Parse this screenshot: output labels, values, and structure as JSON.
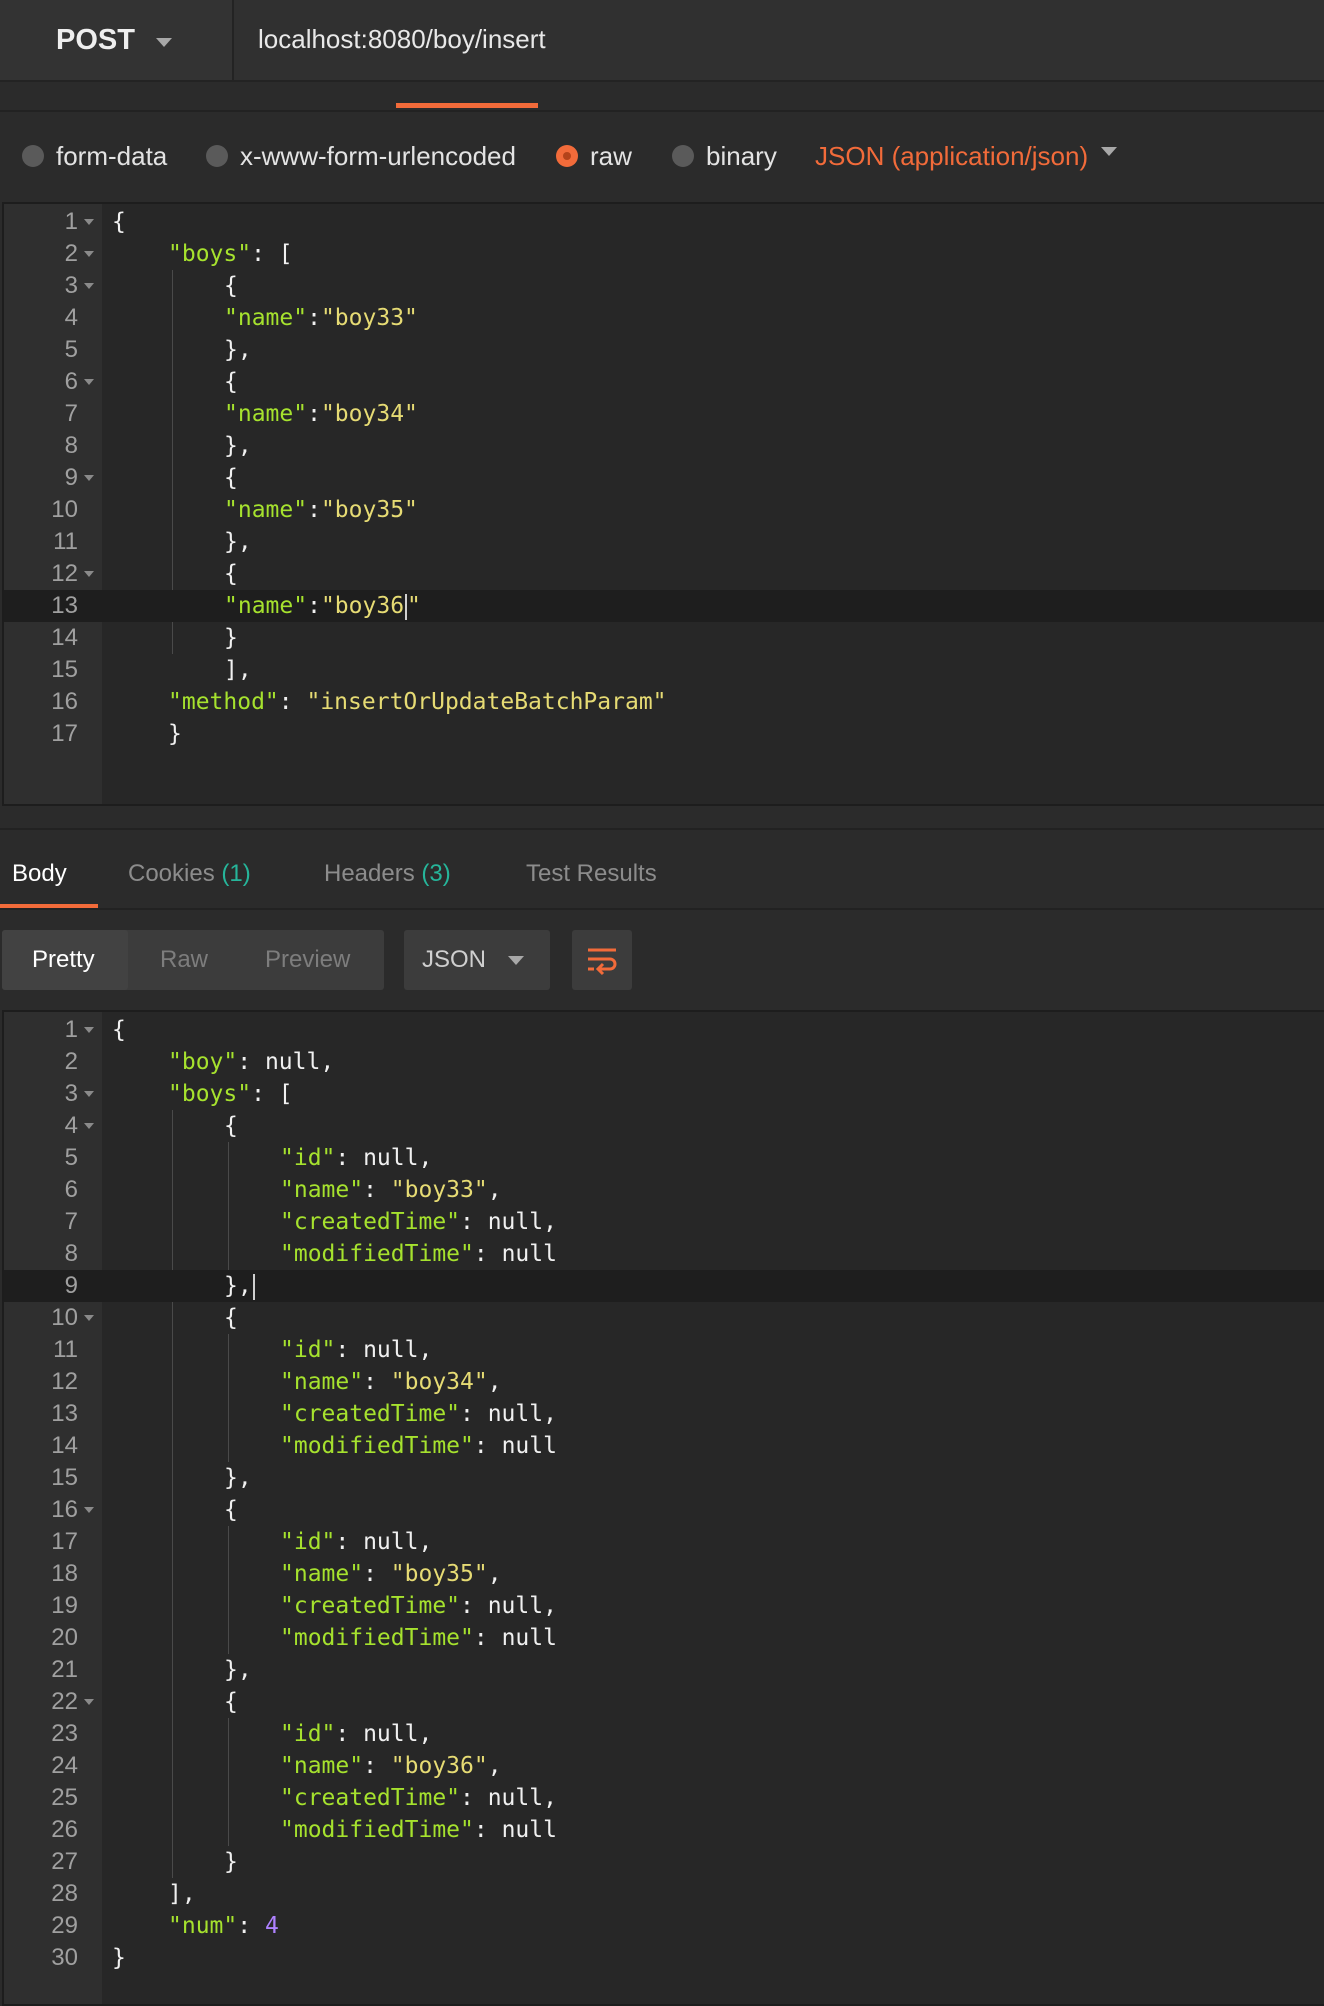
{
  "request": {
    "method": "POST",
    "url": "localhost:8080/boy/insert"
  },
  "body_types": {
    "form_data": "form-data",
    "urlencoded": "x-www-form-urlencoded",
    "raw": "raw",
    "binary": "binary",
    "selected": "raw",
    "content_type": "JSON (application/json)"
  },
  "request_body": [
    {
      "n": "1",
      "t": "{"
    },
    {
      "n": "2",
      "t": "\"boys\": ["
    },
    {
      "n": "3",
      "t": "{"
    },
    {
      "n": "4",
      "t": "\"name\":\"boy33\""
    },
    {
      "n": "5",
      "t": "},"
    },
    {
      "n": "6",
      "t": "{"
    },
    {
      "n": "7",
      "t": "\"name\":\"boy34\""
    },
    {
      "n": "8",
      "t": "},"
    },
    {
      "n": "9",
      "t": "{"
    },
    {
      "n": "10",
      "t": "\"name\":\"boy35\""
    },
    {
      "n": "11",
      "t": "},"
    },
    {
      "n": "12",
      "t": "{"
    },
    {
      "n": "13",
      "t": "\"name\":\"boy36\""
    },
    {
      "n": "14",
      "t": "}"
    },
    {
      "n": "15",
      "t": "],"
    },
    {
      "n": "16",
      "t": "\"method\": \"insertOrUpdateBatchParam\""
    },
    {
      "n": "17",
      "t": "}"
    }
  ],
  "response_tabs": {
    "body": "Body",
    "cookies": "Cookies",
    "cookies_count": "(1)",
    "headers": "Headers",
    "headers_count": "(3)",
    "test_results": "Test Results"
  },
  "response_toolbar": {
    "pretty": "Pretty",
    "raw": "Raw",
    "preview": "Preview",
    "format": "JSON"
  },
  "response_body": [
    {
      "n": "1",
      "t": "{"
    },
    {
      "n": "2",
      "t": "\"boy\": null,"
    },
    {
      "n": "3",
      "t": "\"boys\": ["
    },
    {
      "n": "4",
      "t": "{"
    },
    {
      "n": "5",
      "t": "\"id\": null,"
    },
    {
      "n": "6",
      "t": "\"name\": \"boy33\","
    },
    {
      "n": "7",
      "t": "\"createdTime\": null,"
    },
    {
      "n": "8",
      "t": "\"modifiedTime\": null"
    },
    {
      "n": "9",
      "t": "},"
    },
    {
      "n": "10",
      "t": "{"
    },
    {
      "n": "11",
      "t": "\"id\": null,"
    },
    {
      "n": "12",
      "t": "\"name\": \"boy34\","
    },
    {
      "n": "13",
      "t": "\"createdTime\": null,"
    },
    {
      "n": "14",
      "t": "\"modifiedTime\": null"
    },
    {
      "n": "15",
      "t": "},"
    },
    {
      "n": "16",
      "t": "{"
    },
    {
      "n": "17",
      "t": "\"id\": null,"
    },
    {
      "n": "18",
      "t": "\"name\": \"boy35\","
    },
    {
      "n": "19",
      "t": "\"createdTime\": null,"
    },
    {
      "n": "20",
      "t": "\"modifiedTime\": null"
    },
    {
      "n": "21",
      "t": "},"
    },
    {
      "n": "22",
      "t": "{"
    },
    {
      "n": "23",
      "t": "\"id\": null,"
    },
    {
      "n": "24",
      "t": "\"name\": \"boy36\","
    },
    {
      "n": "25",
      "t": "\"createdTime\": null,"
    },
    {
      "n": "26",
      "t": "\"modifiedTime\": null"
    },
    {
      "n": "27",
      "t": "}"
    },
    {
      "n": "28",
      "t": "],"
    },
    {
      "n": "29",
      "t": "\"num\": 4"
    },
    {
      "n": "30",
      "t": "}"
    }
  ],
  "colors": {
    "accent": "#f26b3a",
    "key": "#a6e22e",
    "string": "#e6db74",
    "number": "#ae81ff",
    "count_badge": "#26b59a"
  },
  "icons": {
    "method_dropdown": "chevron-down-icon",
    "content_type_dropdown": "chevron-down-icon",
    "format_dropdown": "chevron-down-icon",
    "wrap": "wrap-lines-icon"
  }
}
